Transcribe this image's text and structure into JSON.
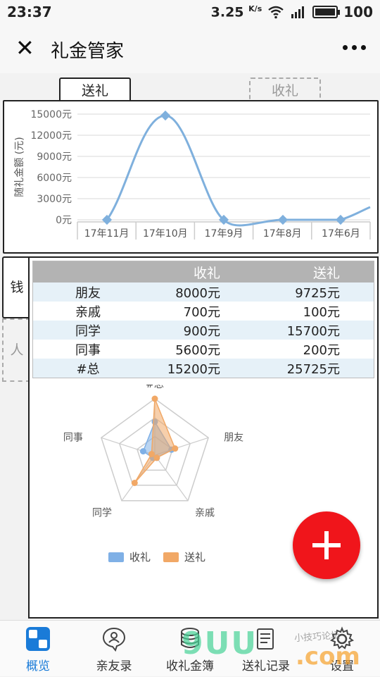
{
  "status": {
    "time": "23:37",
    "speed": "3.25",
    "speed_unit": "K/s",
    "battery": "100"
  },
  "header": {
    "title": "礼金管家"
  },
  "tabs": {
    "send": "送礼",
    "receive": "收礼"
  },
  "side_tabs": {
    "money": "钱",
    "person": "人"
  },
  "line_chart": {
    "ylabel": "随礼金额 (元)",
    "yticks": [
      "15000元",
      "12000元",
      "9000元",
      "6000元",
      "3000元",
      "0元"
    ],
    "ylim": [
      0,
      15000
    ],
    "categories": [
      "17年11月",
      "17年10月",
      "17年9月",
      "17年8月",
      "17年6月"
    ],
    "values": [
      0,
      14800,
      0,
      0,
      0
    ],
    "color": "#7fb0dd"
  },
  "table": {
    "headers": [
      "",
      "收礼",
      "送礼"
    ],
    "rows": [
      [
        "朋友",
        "8000元",
        "9725元"
      ],
      [
        "亲戚",
        "700元",
        "100元"
      ],
      [
        "同学",
        "900元",
        "15700元"
      ],
      [
        "同事",
        "5600元",
        "200元"
      ],
      [
        "#总",
        "15200元",
        "25725元"
      ]
    ]
  },
  "chart_data": {
    "type": "radar",
    "axes": [
      "#总",
      "朋友",
      "亲戚",
      "同学",
      "同事"
    ],
    "series": [
      {
        "name": "收礼",
        "values": [
          15200,
          8000,
          700,
          900,
          5600
        ],
        "color": "#7fb0e6"
      },
      {
        "name": "送礼",
        "values": [
          25725,
          9725,
          100,
          15700,
          200
        ],
        "color": "#f1a866"
      }
    ],
    "max": 25725
  },
  "bottom_nav": [
    {
      "label": "概览",
      "icon": "overview-icon",
      "active": true
    },
    {
      "label": "亲友录",
      "icon": "contacts-icon",
      "active": false
    },
    {
      "label": "收礼金簿",
      "icon": "coins-icon",
      "active": false
    },
    {
      "label": "送礼记录",
      "icon": "record-icon",
      "active": false
    },
    {
      "label": "设置",
      "icon": "gear-icon",
      "active": false
    }
  ],
  "watermark": {
    "text": "9UU",
    "text2": ".com",
    "text3": "小技巧论坛"
  }
}
